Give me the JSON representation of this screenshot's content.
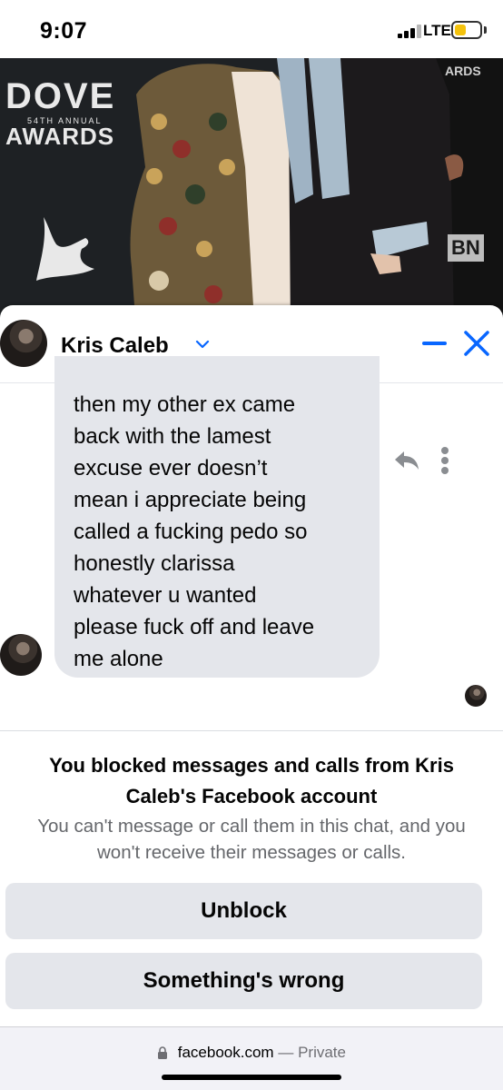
{
  "status_bar": {
    "time": "9:07",
    "network": "LTE",
    "battery_color": "#f4c20d"
  },
  "backdrop": {
    "logo_word": "DOVE",
    "logo_annual": "54TH ANNUAL",
    "logo_awards": "AWARDS",
    "corner_text": "ARDS",
    "badge_text": "BN"
  },
  "chat_header": {
    "contact_name": "Kris Caleb",
    "accent_color": "#0866ff",
    "icons": [
      "chevron-down-icon",
      "minimize-icon",
      "close-icon"
    ]
  },
  "message": {
    "lines": [
      "then my other ex came",
      "back with the lamest",
      "excuse ever doesn’t",
      "mean i appreciate being",
      "called a fucking pedo so",
      "honestly clarissa",
      "whatever u wanted",
      "please fuck off and leave",
      "me alone"
    ],
    "icons": [
      "reply-icon",
      "more-options-icon"
    ]
  },
  "blocked_notice": {
    "title": "You blocked messages and calls from Kris Caleb's Facebook account",
    "description": "You can't message or call them in this chat, and you won't receive their messages or calls."
  },
  "actions": {
    "unblock_label": "Unblock",
    "something_wrong_label": "Something's wrong"
  },
  "browser": {
    "domain": "facebook.com",
    "separator": "—",
    "mode": "Private"
  }
}
